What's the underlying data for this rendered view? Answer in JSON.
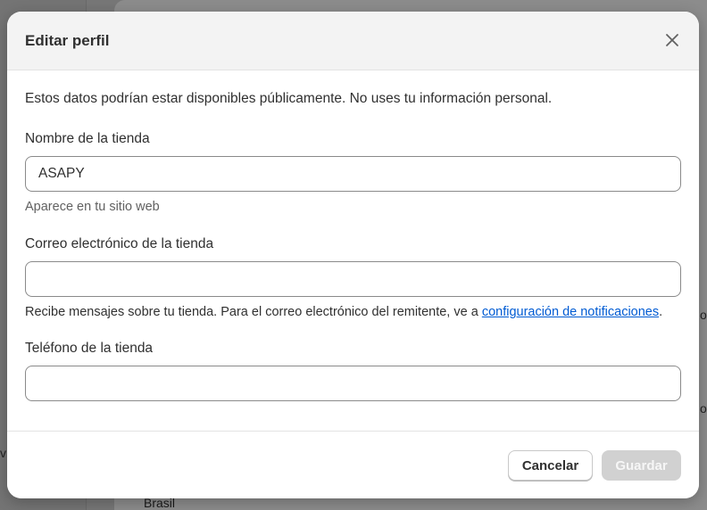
{
  "background": {
    "bottom_text": "Brasil",
    "right_glyph_1": "o",
    "right_glyph_2": "o",
    "left_glyph": "v"
  },
  "modal": {
    "title": "Editar perfil",
    "intro": "Estos datos podrían estar disponibles públicamente. No uses tu información personal.",
    "fields": {
      "store_name": {
        "label": "Nombre de la tienda",
        "value": "ASAPY",
        "help": "Aparece en tu sitio web"
      },
      "store_email": {
        "label": "Correo electrónico de la tienda",
        "value": "",
        "help_prefix": "Recibe mensajes sobre tu tienda. Para el correo electrónico del remitente, ve a ",
        "help_link": "configuración de notificaciones",
        "help_suffix": "."
      },
      "store_phone": {
        "label": "Teléfono de la tienda",
        "value": ""
      }
    },
    "footer": {
      "cancel_label": "Cancelar",
      "save_label": "Guardar"
    }
  },
  "colors": {
    "link": "#005bd3",
    "save_disabled_bg": "#d1d1d1",
    "header_bg": "#f3f3f3"
  },
  "icons": {
    "close": "close-icon"
  }
}
